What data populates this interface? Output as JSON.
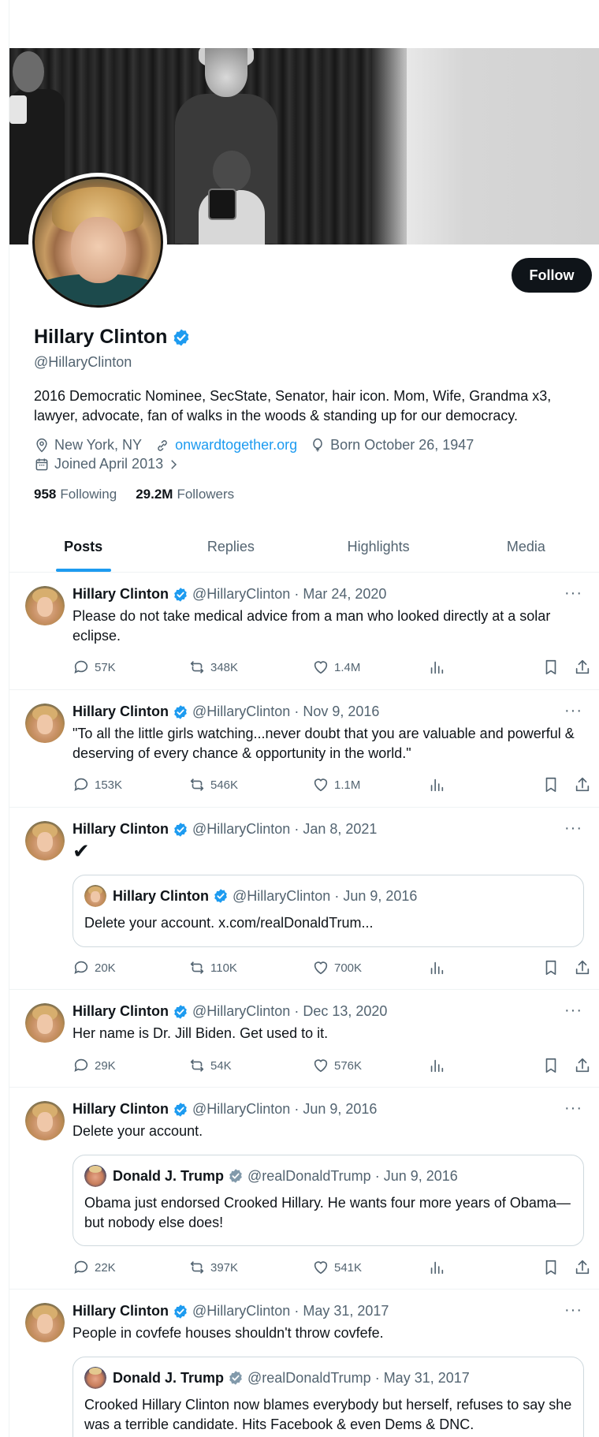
{
  "profile": {
    "name": "Hillary Clinton",
    "handle": "@HillaryClinton",
    "follow_label": "Follow",
    "bio": "2016 Democratic Nominee, SecState, Senator, hair icon. Mom, Wife, Grandma x3, lawyer, advocate, fan of walks in the woods & standing up for our democracy.",
    "location": "New York, NY",
    "website": "onwardtogether.org",
    "born": "Born October 26, 1947",
    "joined": "Joined April 2013",
    "following_count": "958",
    "following_label": "Following",
    "followers_count": "29.2M",
    "followers_label": "Followers"
  },
  "tabs": [
    {
      "label": "Posts",
      "active": true
    },
    {
      "label": "Replies",
      "active": false
    },
    {
      "label": "Highlights",
      "active": false
    },
    {
      "label": "Media",
      "active": false
    }
  ],
  "colors": {
    "accent": "#1d9bf0",
    "text": "#0f1419",
    "muted": "#536471",
    "verified_gray": "#829aab"
  },
  "posts": [
    {
      "name": "Hillary Clinton",
      "handle": "@HillaryClinton",
      "date": "Mar 24, 2020",
      "text": "Please do not take medical advice from a man who looked directly at a solar eclipse.",
      "replies": "57K",
      "reposts": "348K",
      "likes": "1.4M"
    },
    {
      "name": "Hillary Clinton",
      "handle": "@HillaryClinton",
      "date": "Nov 9, 2016",
      "text": "\"To all the little girls watching...never doubt that you are valuable and powerful & deserving of every chance & opportunity in the world.\"",
      "replies": "153K",
      "reposts": "546K",
      "likes": "1.1M"
    },
    {
      "name": "Hillary Clinton",
      "handle": "@HillaryClinton",
      "date": "Jan 8, 2021",
      "text": "✔",
      "quote": {
        "name": "Hillary Clinton",
        "handle": "@HillaryClinton",
        "date": "Jun 9, 2016",
        "text": "Delete your account. x.com/realDonaldTrum..."
      },
      "replies": "20K",
      "reposts": "110K",
      "likes": "700K"
    },
    {
      "name": "Hillary Clinton",
      "handle": "@HillaryClinton",
      "date": "Dec 13, 2020",
      "text": "Her name is Dr. Jill Biden. Get used to it.",
      "replies": "29K",
      "reposts": "54K",
      "likes": "576K"
    },
    {
      "name": "Hillary Clinton",
      "handle": "@HillaryClinton",
      "date": "Jun 9, 2016",
      "text": "Delete your account.",
      "quote": {
        "name": "Donald J. Trump",
        "handle": "@realDonaldTrump",
        "date": "Jun 9, 2016",
        "text": "Obama just endorsed Crooked Hillary. He wants four more years of Obama—but nobody else does!"
      },
      "replies": "22K",
      "reposts": "397K",
      "likes": "541K"
    },
    {
      "name": "Hillary Clinton",
      "handle": "@HillaryClinton",
      "date": "May 31, 2017",
      "text": "People in covfefe houses shouldn't throw covfefe.",
      "quote": {
        "name": "Donald J. Trump",
        "handle": "@realDonaldTrump",
        "date": "May 31, 2017",
        "text": "Crooked Hillary Clinton now blames everybody but herself, refuses to say she was a terrible candidate. Hits Facebook & even Dems & DNC."
      }
    }
  ],
  "separator": "·",
  "more_glyph": "···"
}
